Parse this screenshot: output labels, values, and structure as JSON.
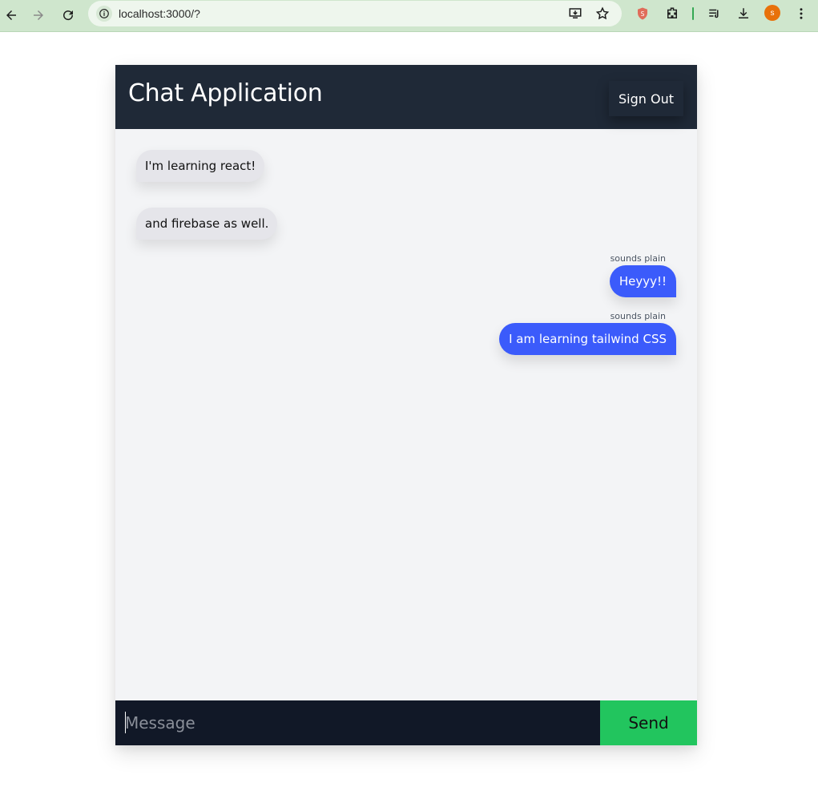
{
  "browser": {
    "url": "localhost:3000/?",
    "profile_initial": "s"
  },
  "app": {
    "title": "Chat Application",
    "signout_label": "Sign Out"
  },
  "messages": [
    {
      "text": "I'm learning react!",
      "side": "left"
    },
    {
      "text": "and firebase as well.",
      "side": "left"
    },
    {
      "text": "Heyyy!!",
      "side": "right",
      "sender": "sounds plain"
    },
    {
      "text": "I am learning tailwind CSS",
      "side": "right",
      "sender": "sounds plain"
    }
  ],
  "composer": {
    "placeholder": "Message",
    "send_label": "Send"
  },
  "colors": {
    "header": "#1f2937",
    "own_bubble": "#3b5bfb",
    "other_bubble": "#e5e5ea",
    "send_button": "#22c55e"
  }
}
